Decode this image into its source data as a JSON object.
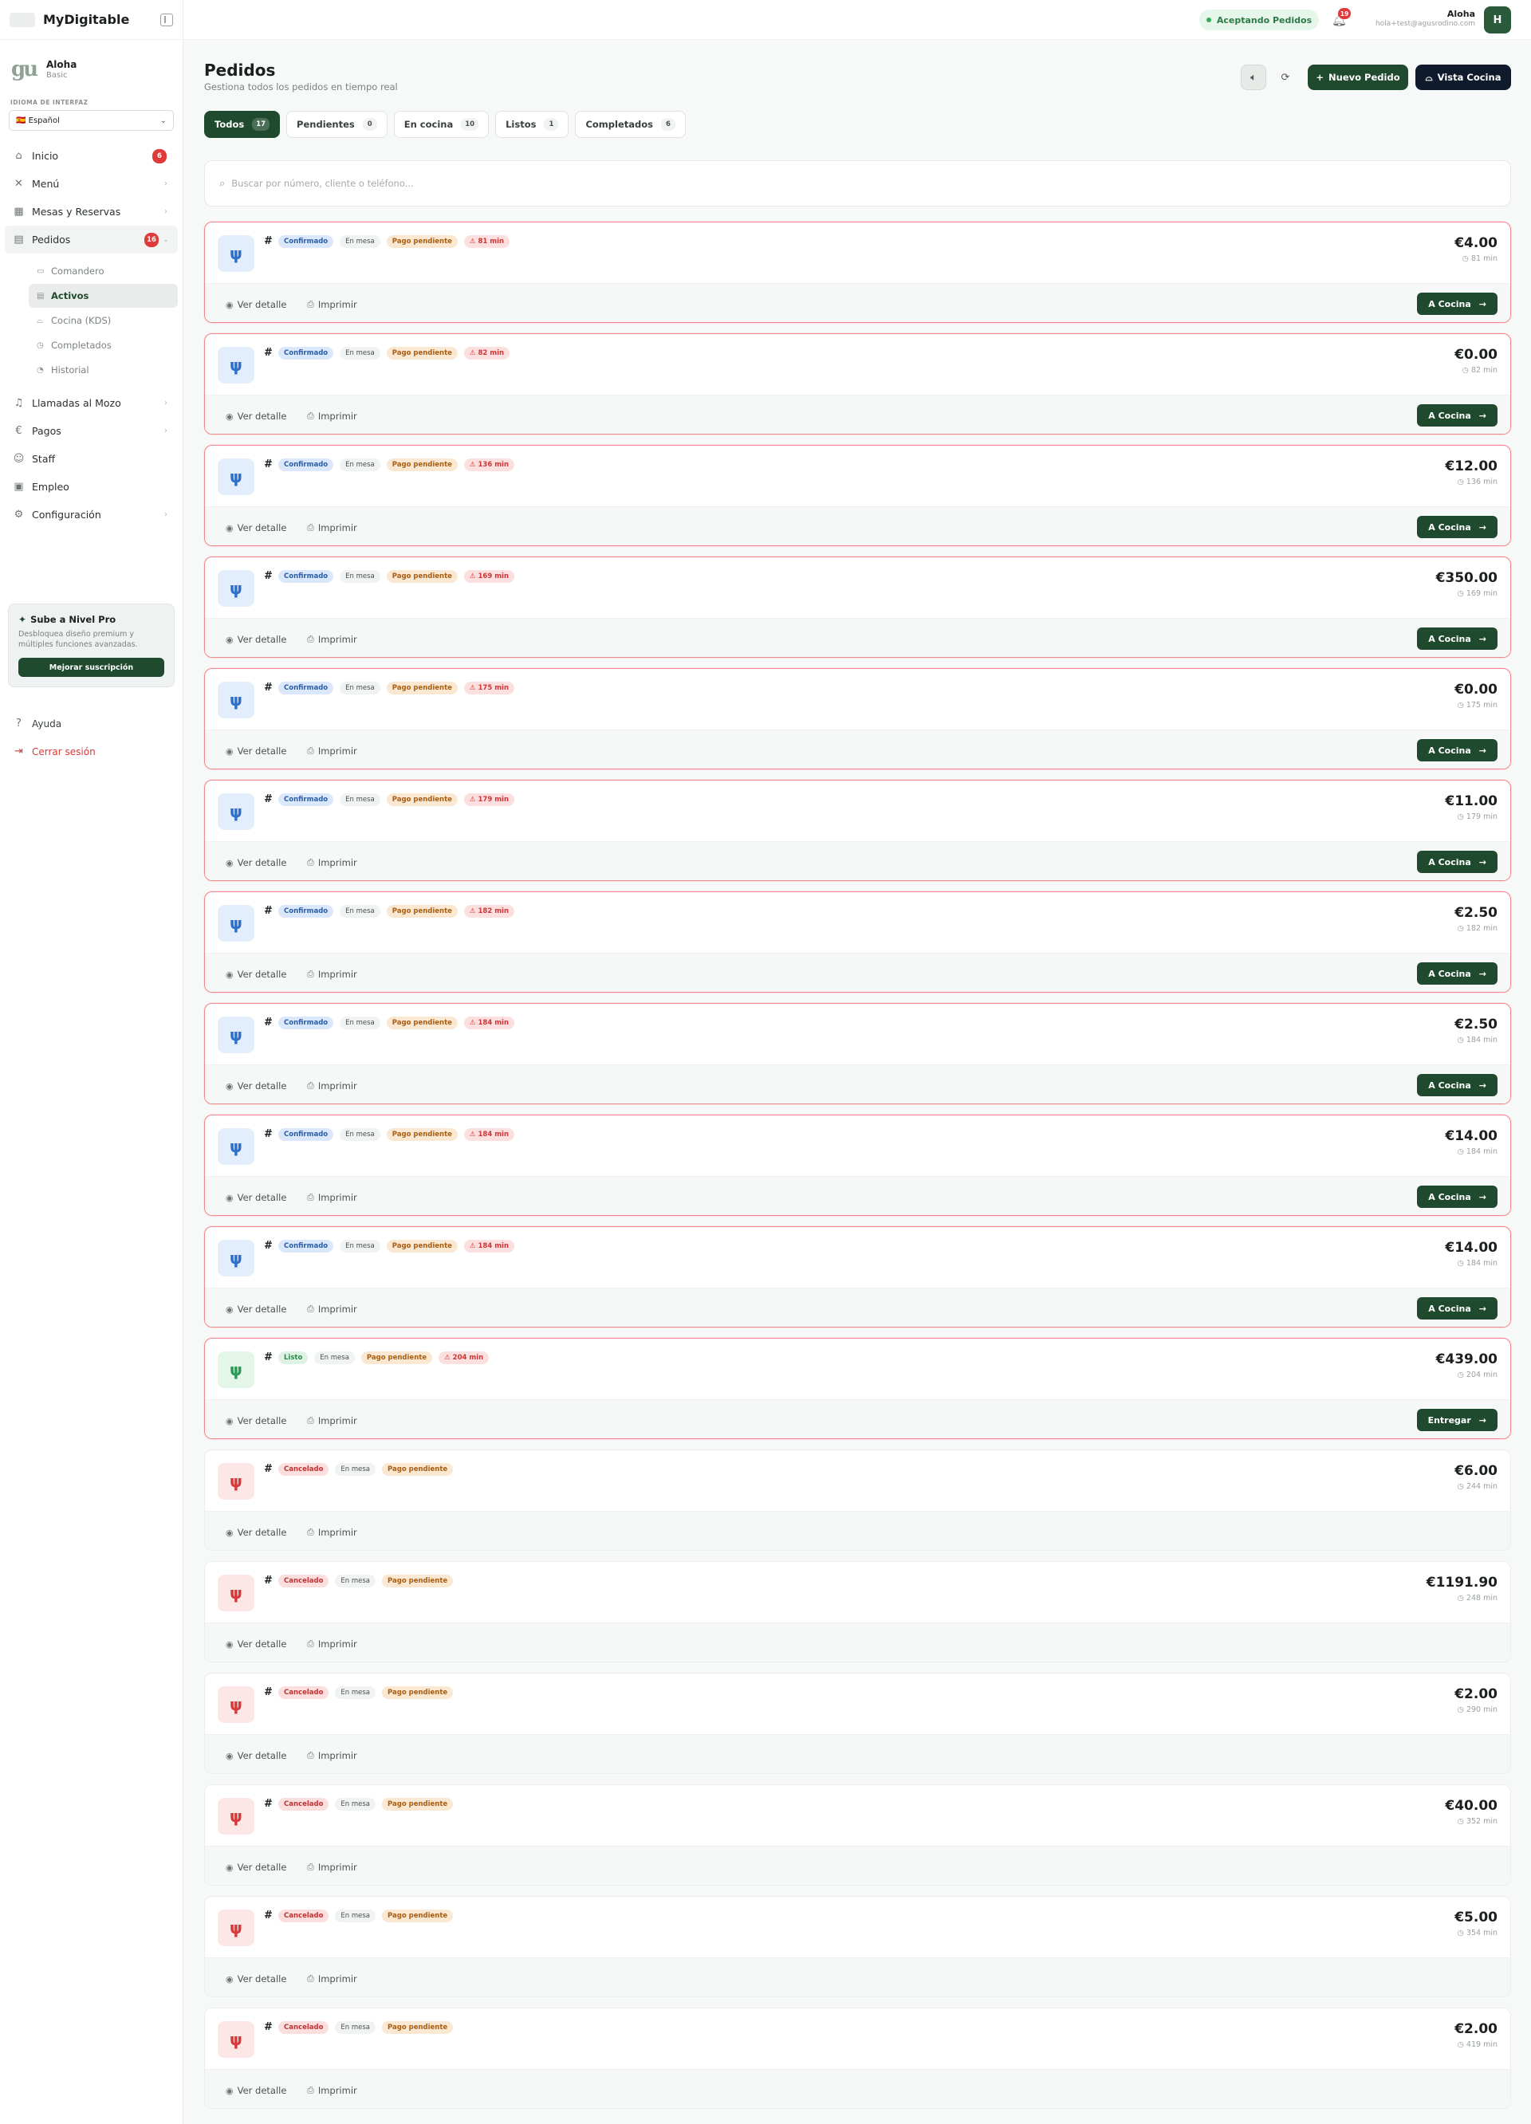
{
  "brand": {
    "name": "MyDigitable"
  },
  "account": {
    "name": "Aloha",
    "plan": "Basic"
  },
  "language": {
    "label": "IDIOMA DE INTERFAZ",
    "value": "Español",
    "flag": "🇪🇸"
  },
  "nav": [
    {
      "label": "Inicio",
      "icon": "home-icon",
      "badge": "6",
      "chevron": ""
    },
    {
      "label": "Menú",
      "icon": "utensils-icon",
      "badge": "",
      "chevron": "›"
    },
    {
      "label": "Mesas y Reservas",
      "icon": "calendar-icon",
      "badge": "",
      "chevron": "›"
    },
    {
      "label": "Pedidos",
      "icon": "clipboard-icon",
      "badge": "16",
      "chevron": "⌄"
    }
  ],
  "subnav": [
    {
      "label": "Comandero",
      "icon": "monitor-icon"
    },
    {
      "label": "Activos",
      "icon": "clipboard-icon"
    },
    {
      "label": "Cocina (KDS)",
      "icon": "chef-hat-icon"
    },
    {
      "label": "Completados",
      "icon": "check-circle-icon"
    },
    {
      "label": "Historial",
      "icon": "history-icon"
    }
  ],
  "nav2": [
    {
      "label": "Llamadas al Mozo",
      "icon": "bell-icon",
      "chevron": "›"
    },
    {
      "label": "Pagos",
      "icon": "euro-icon",
      "chevron": "›"
    },
    {
      "label": "Staff",
      "icon": "users-icon",
      "chevron": ""
    },
    {
      "label": "Empleo",
      "icon": "briefcase-icon",
      "chevron": ""
    },
    {
      "label": "Configuración",
      "icon": "gear-icon",
      "chevron": "›"
    }
  ],
  "promo": {
    "title": "Sube a Nivel Pro",
    "description": "Desbloquea diseño premium y múltiples funciones avanzadas.",
    "button": "Mejorar suscripción"
  },
  "footer": {
    "help": "Ayuda",
    "logout": "Cerrar sesión"
  },
  "topbar": {
    "status": "Aceptando Pedidos",
    "notifications": "19",
    "user_name": "Aloha",
    "user_email": "hola+test@agusrodino.com",
    "avatar": "H"
  },
  "page": {
    "title": "Pedidos",
    "subtitle": "Gestiona todos los pedidos en tiempo real",
    "new_order": "Nuevo Pedido",
    "kitchen_view": "Vista Cocina"
  },
  "tabs": [
    {
      "label": "Todos",
      "count": "17"
    },
    {
      "label": "Pendientes",
      "count": "0"
    },
    {
      "label": "En cocina",
      "count": "10"
    },
    {
      "label": "Listos",
      "count": "1"
    },
    {
      "label": "Completados",
      "count": "6"
    }
  ],
  "search": {
    "placeholder": "Buscar por número, cliente o teléfono..."
  },
  "labels": {
    "view_detail": "Ver detalle",
    "print": "Imprimir",
    "hash": "#"
  },
  "orders": [
    {
      "status": "Confirmado",
      "kind": "confirmed",
      "service": "En mesa",
      "payment": "Pago pendiente",
      "late": "81 min",
      "amount": "€4.00",
      "elapsed": "81 min",
      "action": "A Cocina"
    },
    {
      "status": "Confirmado",
      "kind": "confirmed",
      "service": "En mesa",
      "payment": "Pago pendiente",
      "late": "82 min",
      "amount": "€0.00",
      "elapsed": "82 min",
      "action": "A Cocina"
    },
    {
      "status": "Confirmado",
      "kind": "confirmed",
      "service": "En mesa",
      "payment": "Pago pendiente",
      "late": "136 min",
      "amount": "€12.00",
      "elapsed": "136 min",
      "action": "A Cocina"
    },
    {
      "status": "Confirmado",
      "kind": "confirmed",
      "service": "En mesa",
      "payment": "Pago pendiente",
      "late": "169 min",
      "amount": "€350.00",
      "elapsed": "169 min",
      "action": "A Cocina"
    },
    {
      "status": "Confirmado",
      "kind": "confirmed",
      "service": "En mesa",
      "payment": "Pago pendiente",
      "late": "175 min",
      "amount": "€0.00",
      "elapsed": "175 min",
      "action": "A Cocina"
    },
    {
      "status": "Confirmado",
      "kind": "confirmed",
      "service": "En mesa",
      "payment": "Pago pendiente",
      "late": "179 min",
      "amount": "€11.00",
      "elapsed": "179 min",
      "action": "A Cocina"
    },
    {
      "status": "Confirmado",
      "kind": "confirmed",
      "service": "En mesa",
      "payment": "Pago pendiente",
      "late": "182 min",
      "amount": "€2.50",
      "elapsed": "182 min",
      "action": "A Cocina"
    },
    {
      "status": "Confirmado",
      "kind": "confirmed",
      "service": "En mesa",
      "payment": "Pago pendiente",
      "late": "184 min",
      "amount": "€2.50",
      "elapsed": "184 min",
      "action": "A Cocina"
    },
    {
      "status": "Confirmado",
      "kind": "confirmed",
      "service": "En mesa",
      "payment": "Pago pendiente",
      "late": "184 min",
      "amount": "€14.00",
      "elapsed": "184 min",
      "action": "A Cocina"
    },
    {
      "status": "Confirmado",
      "kind": "confirmed",
      "service": "En mesa",
      "payment": "Pago pendiente",
      "late": "184 min",
      "amount": "€14.00",
      "elapsed": "184 min",
      "action": "A Cocina"
    },
    {
      "status": "Listo",
      "kind": "ready",
      "service": "En mesa",
      "payment": "Pago pendiente",
      "late": "204 min",
      "amount": "€439.00",
      "elapsed": "204 min",
      "action": "Entregar"
    },
    {
      "status": "Cancelado",
      "kind": "cancelled",
      "service": "En mesa",
      "payment": "Pago pendiente",
      "late": "",
      "amount": "€6.00",
      "elapsed": "244 min",
      "action": ""
    },
    {
      "status": "Cancelado",
      "kind": "cancelled",
      "service": "En mesa",
      "payment": "Pago pendiente",
      "late": "",
      "amount": "€1191.90",
      "elapsed": "248 min",
      "action": ""
    },
    {
      "status": "Cancelado",
      "kind": "cancelled",
      "service": "En mesa",
      "payment": "Pago pendiente",
      "late": "",
      "amount": "€2.00",
      "elapsed": "290 min",
      "action": ""
    },
    {
      "status": "Cancelado",
      "kind": "cancelled",
      "service": "En mesa",
      "payment": "Pago pendiente",
      "late": "",
      "amount": "€40.00",
      "elapsed": "352 min",
      "action": ""
    },
    {
      "status": "Cancelado",
      "kind": "cancelled",
      "service": "En mesa",
      "payment": "Pago pendiente",
      "late": "",
      "amount": "€5.00",
      "elapsed": "354 min",
      "action": ""
    },
    {
      "status": "Cancelado",
      "kind": "cancelled",
      "service": "En mesa",
      "payment": "Pago pendiente",
      "late": "",
      "amount": "€2.00",
      "elapsed": "419 min",
      "action": ""
    }
  ],
  "colors": {
    "primary": "#1f4a2e",
    "kitchen": "#0f1a2c",
    "danger": "#e03b3b",
    "late_border": "#f08a8a"
  }
}
